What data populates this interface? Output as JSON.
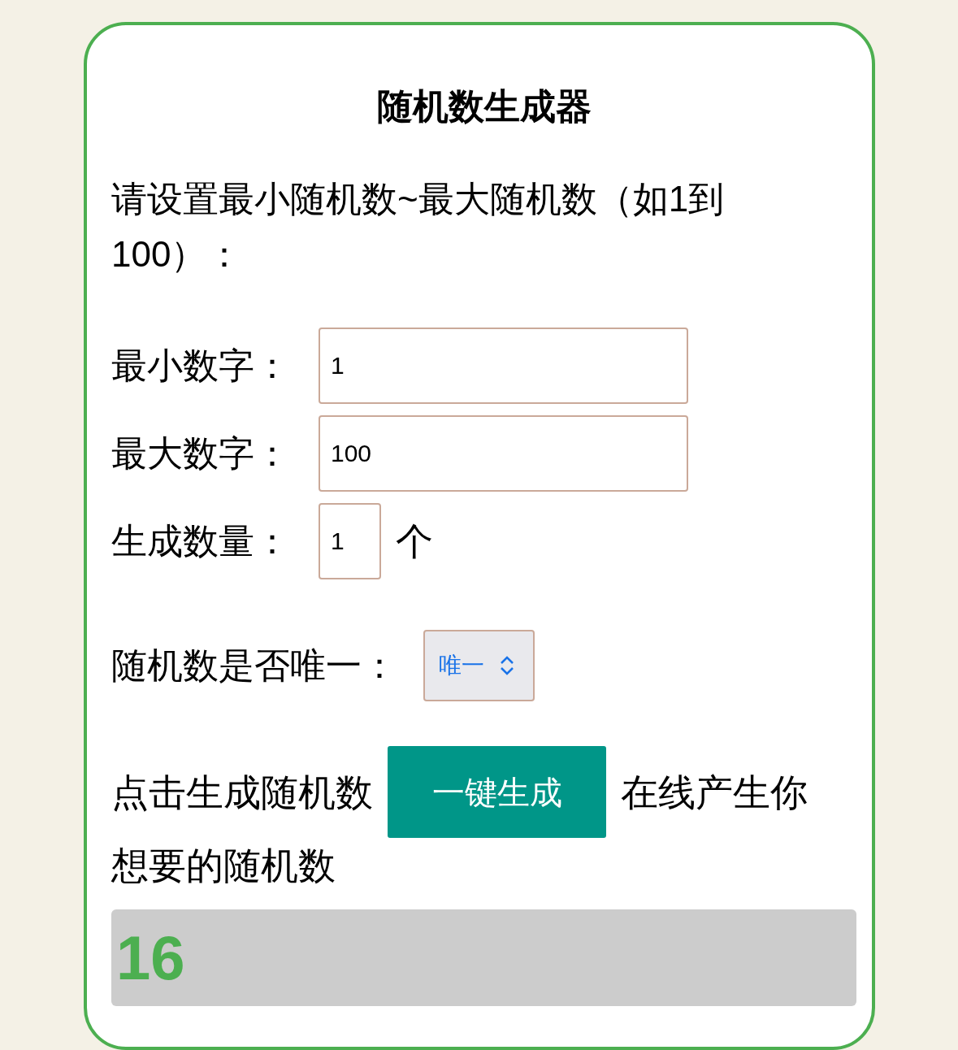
{
  "title": "随机数生成器",
  "instruction": "请设置最小随机数~最大随机数（如1到100）：",
  "fields": [
    {
      "label": "最小数字：",
      "value": "1",
      "kind": "wide"
    },
    {
      "label": "最大数字：",
      "value": "100",
      "kind": "wide"
    },
    {
      "label": "生成数量：",
      "value": "1",
      "kind": "narrow",
      "unit": "个"
    }
  ],
  "unique": {
    "label": "随机数是否唯一：",
    "value": "唯一"
  },
  "generate": {
    "before": "点击生成随机数",
    "button": "一键生成",
    "after": [
      "在线产生你",
      "想要的随机数"
    ]
  },
  "result": "16"
}
